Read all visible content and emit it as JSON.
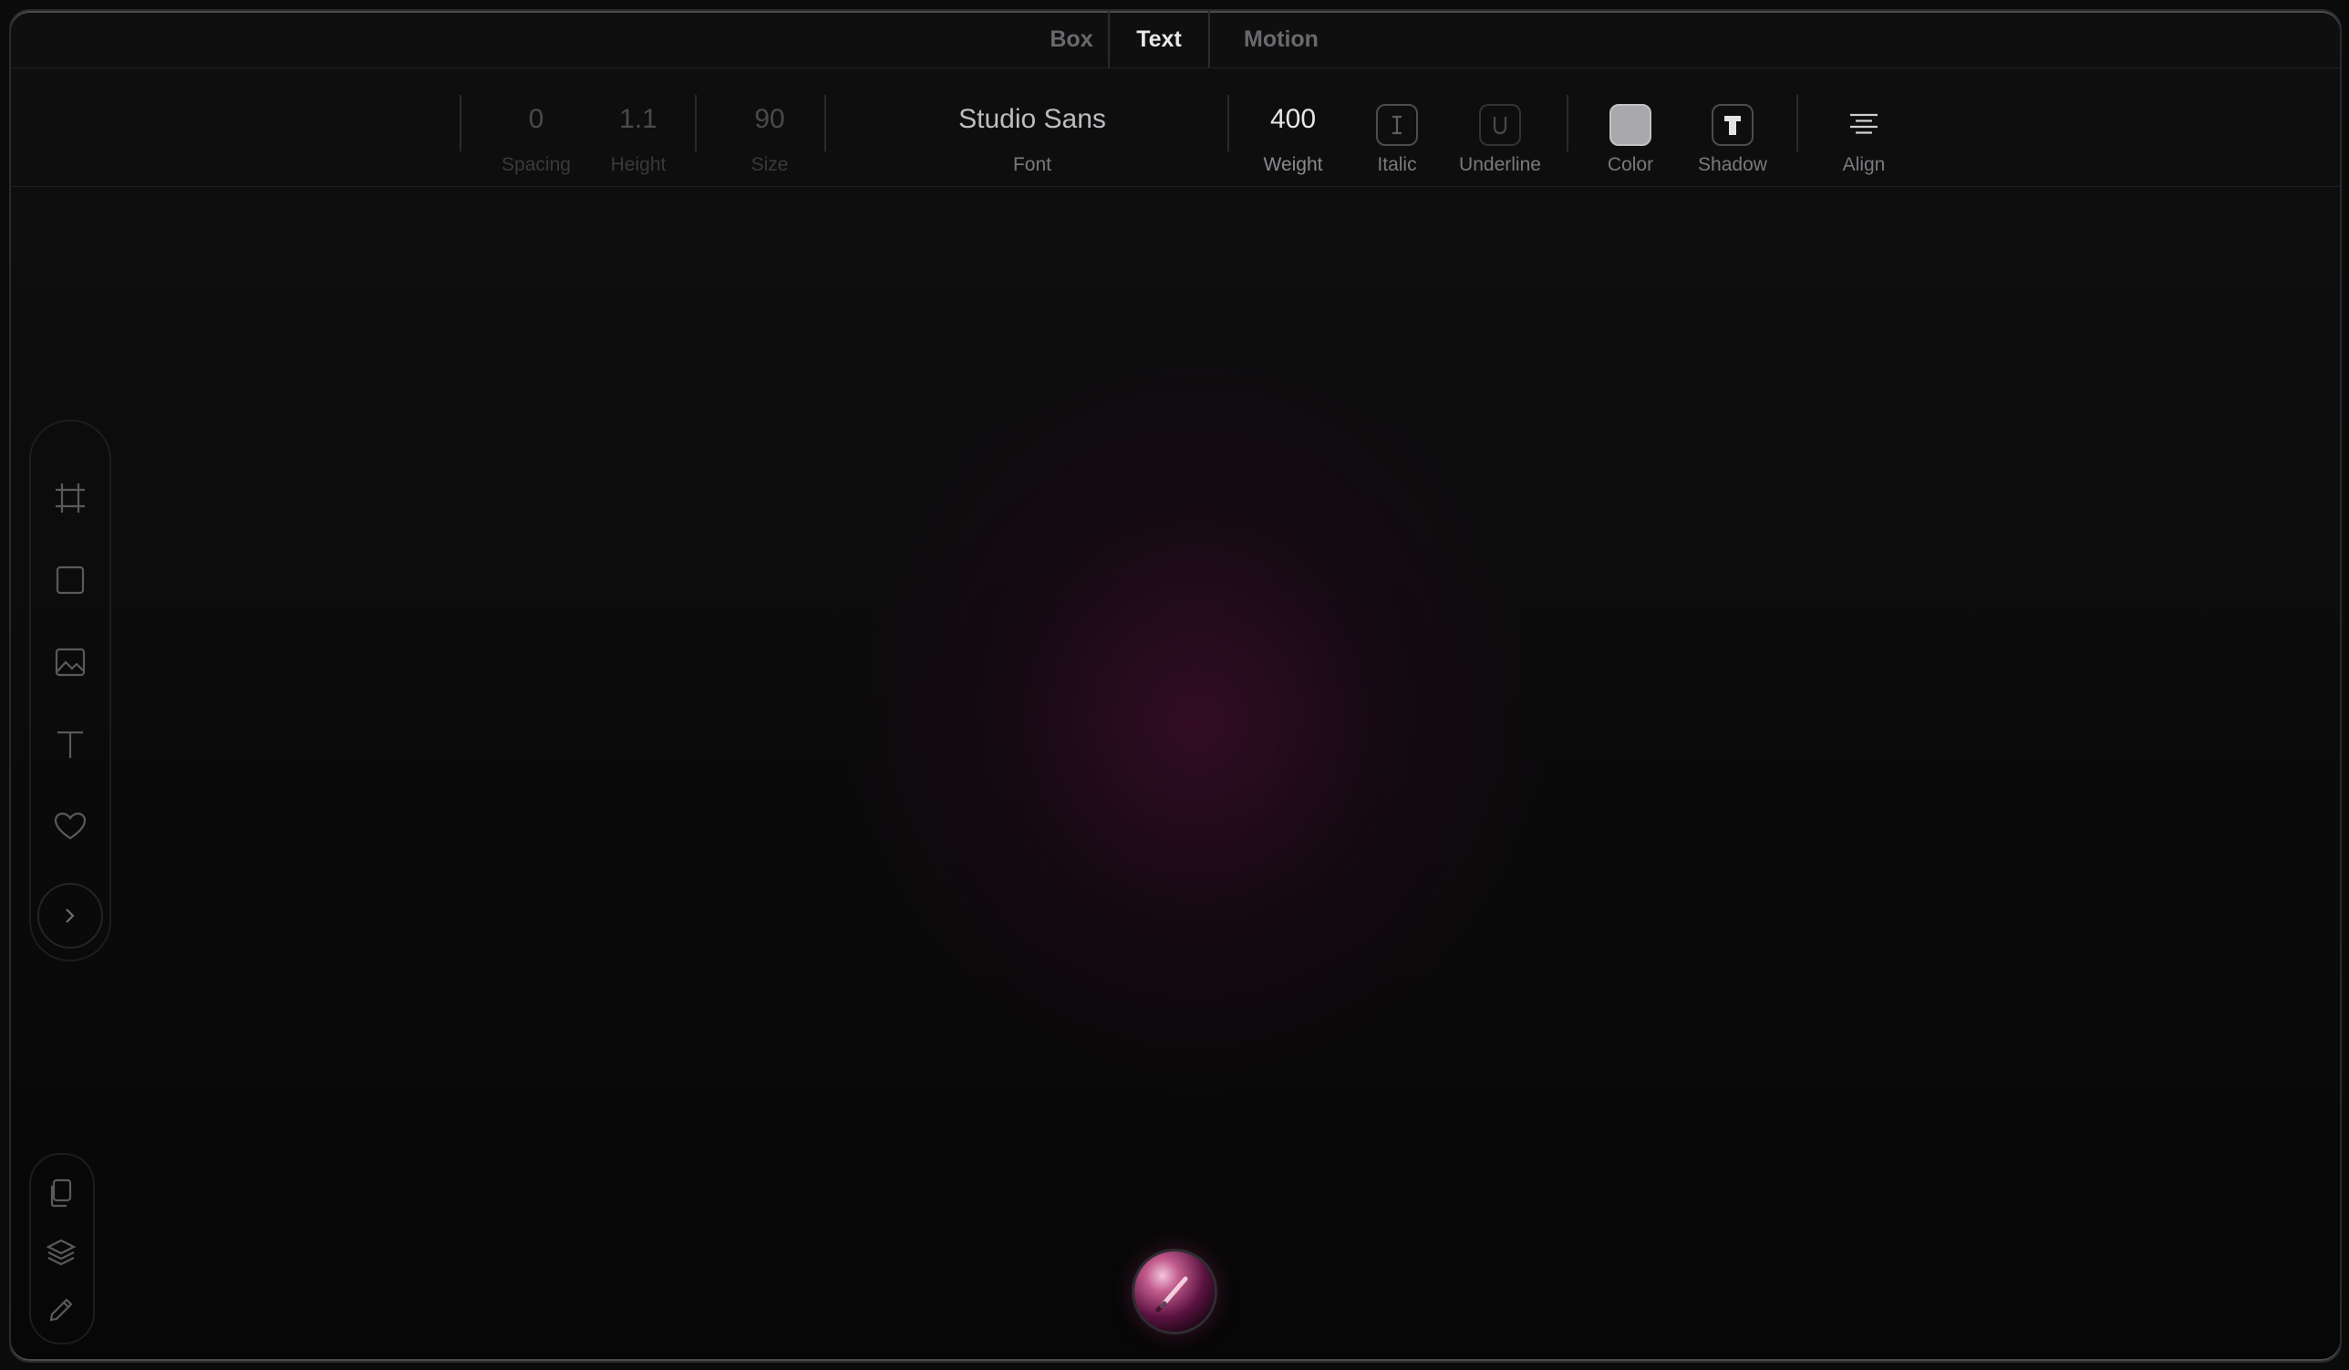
{
  "tabs": {
    "box": "Box",
    "text": "Text",
    "motion": "Motion",
    "active": "Text"
  },
  "toolbar": {
    "spacing": {
      "value": "0",
      "label": "Spacing"
    },
    "height": {
      "value": "1.1",
      "label": "Height"
    },
    "size": {
      "value": "90",
      "label": "Size"
    },
    "font": {
      "value": "Studio Sans",
      "label": "Font"
    },
    "weight": {
      "value": "400",
      "label": "Weight"
    },
    "italic": {
      "icon": "italic-icon",
      "glyph": "I",
      "label": "Italic"
    },
    "underline": {
      "icon": "underline-icon",
      "glyph": "U",
      "label": "Underline"
    },
    "color": {
      "swatch": "#a9a9ac",
      "label": "Color"
    },
    "shadow": {
      "icon": "shadow-text-icon",
      "glyph": "T",
      "label": "Shadow"
    },
    "align": {
      "icon": "align-center-icon",
      "label": "Align"
    }
  },
  "left_rail": {
    "tools": [
      "frame-icon",
      "rectangle-icon",
      "image-icon",
      "text-icon",
      "heart-icon"
    ],
    "expand": "chevron-right-icon"
  },
  "bottom_rail": {
    "tools": [
      "copy-icon",
      "layers-icon",
      "pencil-icon"
    ]
  },
  "assistant": {
    "icon": "ai-orb-icon"
  },
  "colors": {
    "background": "#0b0b0c",
    "glow": "#520e3a",
    "active_text": "#e9e9ec",
    "inactive_text": "#6a6a6e"
  }
}
